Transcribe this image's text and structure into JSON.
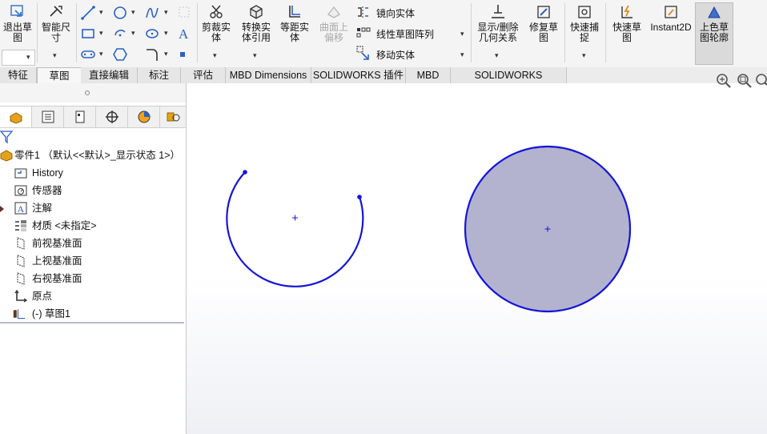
{
  "ribbon": {
    "buttons": [
      {
        "id": "exit-sketch",
        "label": "退出草图"
      },
      {
        "id": "smart-dimension",
        "label": "智能尺寸"
      },
      {
        "id": "trim",
        "label": "剪裁实体"
      },
      {
        "id": "convert",
        "label": "转换实体引用"
      },
      {
        "id": "offset",
        "label": "等距实体"
      },
      {
        "id": "surface-offset",
        "label": "曲面上偏移"
      },
      {
        "id": "display-relations",
        "label": "显示/删除几何关系"
      },
      {
        "id": "repair-sketch",
        "label": "修复草图"
      },
      {
        "id": "quick-snap",
        "label": "快速捕捉"
      },
      {
        "id": "rapid-sketch",
        "label": "快速草图"
      },
      {
        "id": "instant2d",
        "label": "Instant2D"
      },
      {
        "id": "shaded-contours",
        "label": "上色草图轮廓"
      }
    ],
    "rows": {
      "mirror": "镜向实体",
      "linear_pattern": "线性草图阵列",
      "move": "移动实体"
    }
  },
  "tabs": [
    {
      "label": "特征"
    },
    {
      "label": "草图",
      "active": true
    },
    {
      "label": "直接编辑"
    },
    {
      "label": "标注"
    },
    {
      "label": "评估"
    },
    {
      "label": "MBD Dimensions"
    },
    {
      "label": "SOLIDWORKS 插件"
    },
    {
      "label": "MBD"
    },
    {
      "label": "SOLIDWORKS Inspection"
    }
  ],
  "tree": {
    "root": "零件1 （默认<<默认>_显示状态 1>）",
    "items": [
      {
        "label": "History",
        "icon": "history-icon"
      },
      {
        "label": "传感器",
        "icon": "sensor-icon"
      },
      {
        "label": "注解",
        "icon": "annotation-icon"
      },
      {
        "label": "材质 <未指定>",
        "icon": "material-icon"
      },
      {
        "label": "前视基准面",
        "icon": "plane-icon"
      },
      {
        "label": "上视基准面",
        "icon": "plane-icon"
      },
      {
        "label": "右视基准面",
        "icon": "plane-icon"
      },
      {
        "label": "原点",
        "icon": "origin-icon"
      },
      {
        "label": "(-) 草图1",
        "icon": "sketch-icon"
      }
    ]
  },
  "colors": {
    "sketch_line": "#1515d8",
    "shaded_fill": "#b3b3cf",
    "accent": "#2a62c4"
  }
}
